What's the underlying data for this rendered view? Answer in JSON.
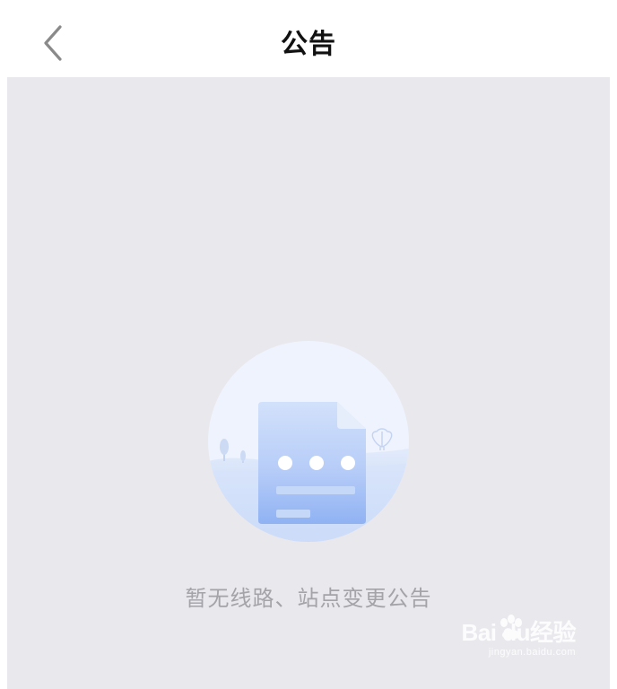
{
  "header": {
    "title": "公告",
    "back_icon": "chevron-left-icon"
  },
  "empty_state": {
    "illustration_icon": "empty-document-icon",
    "message": "暂无线路、站点变更公告"
  },
  "watermark": {
    "brand": "Bai du经验",
    "url": "jingyan.baidu.com"
  },
  "colors": {
    "background": "#e9e8ed",
    "header_background": "#ffffff",
    "title": "#111111",
    "message": "#a3a3a8",
    "illustration_accent": "#8fb3f5"
  }
}
